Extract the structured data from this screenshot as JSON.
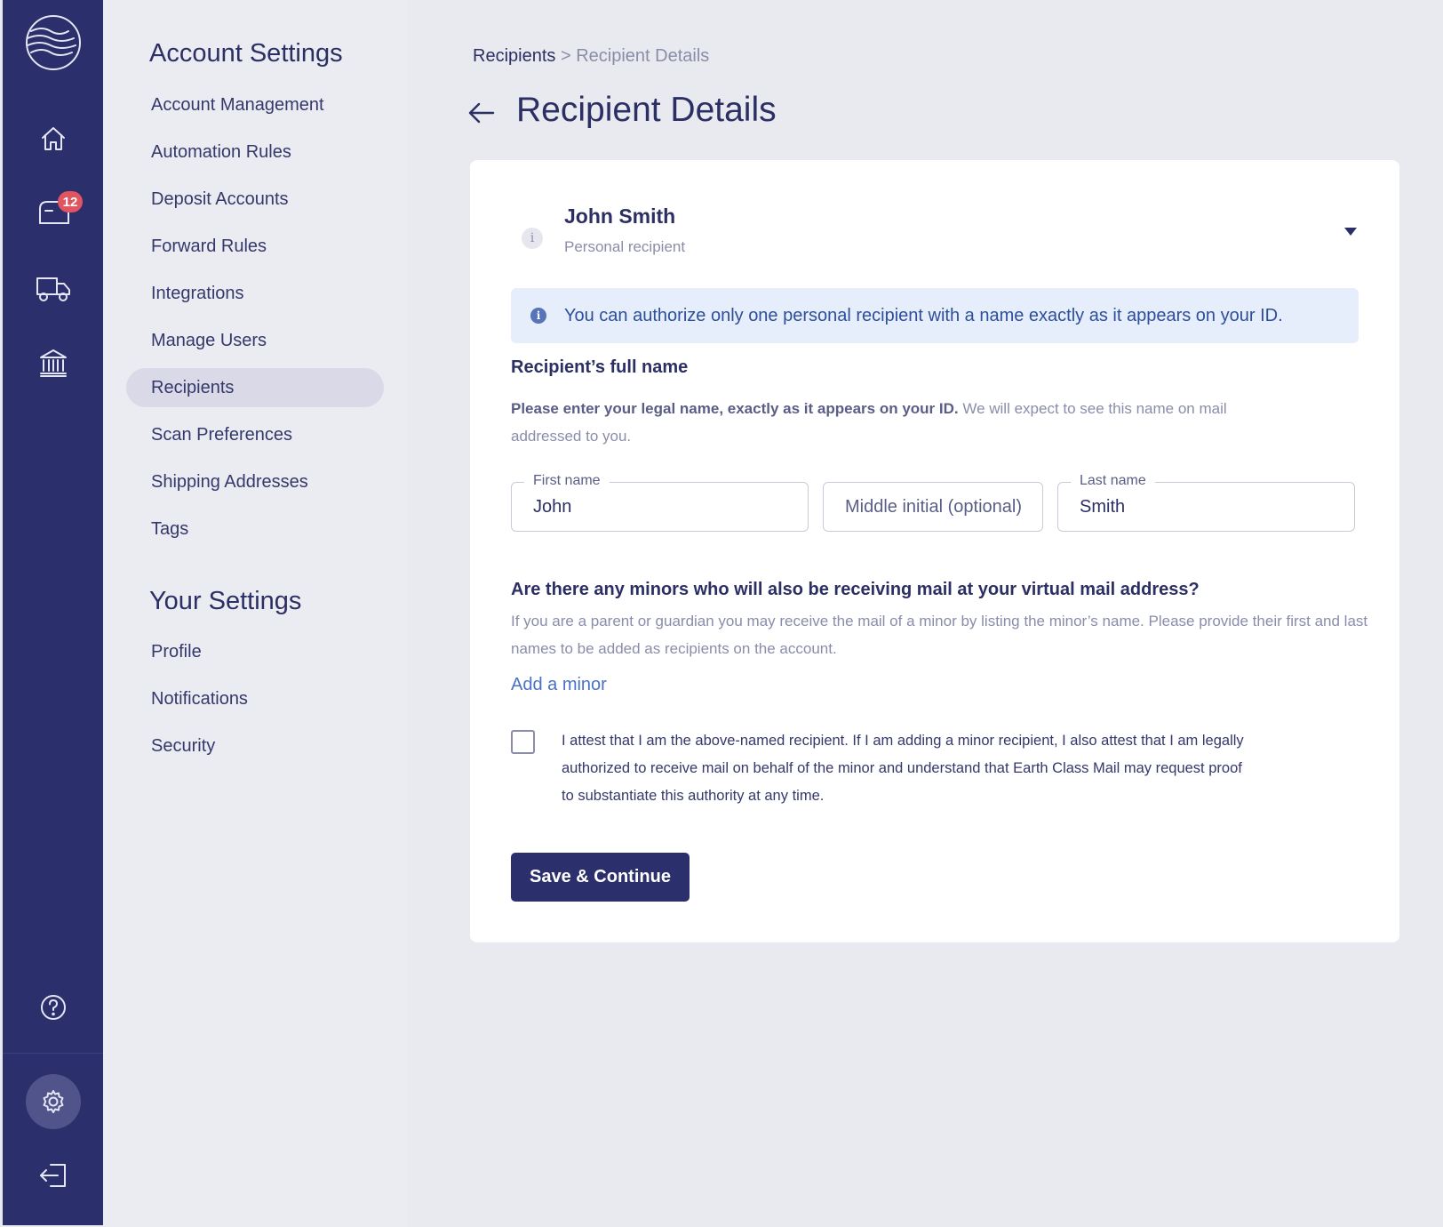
{
  "rail": {
    "notification_count": "12",
    "icons": [
      "logo-icon",
      "home-icon",
      "mailbox-icon",
      "truck-icon",
      "bank-icon",
      "help-icon",
      "gear-icon",
      "logout-icon"
    ]
  },
  "settings": {
    "account_heading": "Account Settings",
    "account_items": [
      "Account Management",
      "Automation Rules",
      "Deposit Accounts",
      "Forward Rules",
      "Integrations",
      "Manage Users",
      "Recipients",
      "Scan Preferences",
      "Shipping Addresses",
      "Tags"
    ],
    "active_item": "Recipients",
    "your_heading": "Your Settings",
    "your_items": [
      "Profile",
      "Notifications",
      "Security"
    ]
  },
  "breadcrumb": {
    "parent": "Recipients",
    "separator": ">",
    "current": "Recipient Details"
  },
  "page_title": "Recipient Details",
  "recipient": {
    "name": "John Smith",
    "type": "Personal recipient"
  },
  "notice": "You can authorize only one personal recipient with a name exactly as it appears on your ID.",
  "full_name": {
    "label": "Recipient’s full name",
    "help_bold": "Please enter your legal name, exactly as it appears on your ID.",
    "help_rest": " We will expect to see this name on mail addressed to you.",
    "first_name_label": "First name",
    "first_name_value": "John",
    "middle_placeholder": "Middle initial (optional)",
    "last_name_label": "Last name",
    "last_name_value": "Smith"
  },
  "minors": {
    "question": "Are there any minors who will also be receiving mail at your virtual mail address?",
    "help": "If you are a parent or guardian you may receive the mail of a minor by listing the minor’s name. Please provide their first and last names to be added as recipients on the account.",
    "add_link": "Add a minor"
  },
  "attestation": {
    "checked": false,
    "text": "I attest that I am the above-named recipient. If I am adding a minor recipient, I also attest that I am legally authorized to receive mail on behalf of the minor and understand that Earth Class Mail may request proof to substantiate this authority at any time."
  },
  "save_button": "Save & Continue",
  "colors": {
    "rail": "#2b2f6b",
    "primary": "#2b2f6b",
    "badge": "#e0555f",
    "link": "#4a71c7",
    "notice_bg": "#e7eefb"
  }
}
